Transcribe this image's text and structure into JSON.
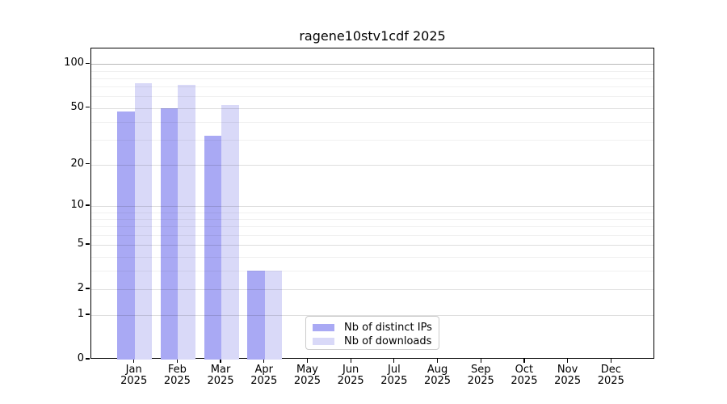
{
  "title": "ragene10stv1cdf 2025",
  "colors": {
    "distinct_ips": "#a9a9f4",
    "downloads": "#d9d9f8",
    "grid_major": "rgba(0,0,0,0.13)",
    "grid_major_100": "rgba(0,0,0,0.28)",
    "grid_minor": "rgba(0,0,0,0.06)",
    "axis": "#000000"
  },
  "legend": {
    "items": [
      {
        "label": "Nb of distinct IPs",
        "color_key": "distinct_ips"
      },
      {
        "label": "Nb of downloads",
        "color_key": "downloads"
      }
    ]
  },
  "chart_data": {
    "type": "bar",
    "title": "ragene10stv1cdf 2025",
    "categories": [
      "Jan 2025",
      "Feb 2025",
      "Mar 2025",
      "Apr 2025",
      "May 2025",
      "Jun 2025",
      "Jul 2025",
      "Aug 2025",
      "Sep 2025",
      "Oct 2025",
      "Nov 2025",
      "Dec 2025"
    ],
    "series": [
      {
        "name": "Nb of distinct IPs",
        "values": [
          47,
          50,
          32,
          3,
          null,
          null,
          null,
          null,
          null,
          null,
          null,
          null
        ]
      },
      {
        "name": "Nb of downloads",
        "values": [
          74,
          72,
          52,
          3,
          null,
          null,
          null,
          null,
          null,
          null,
          null,
          null
        ]
      }
    ],
    "xlabel": "",
    "ylabel": "",
    "yscale": "log(value+1)",
    "y_major_ticks": [
      0,
      1,
      2,
      5,
      10,
      20,
      50,
      100
    ],
    "y_minor_ticks": [
      3,
      4,
      6,
      7,
      8,
      9,
      30,
      40,
      60,
      70,
      80,
      90
    ],
    "ylim": [
      0,
      127
    ],
    "grid": true,
    "legend_position": "lower center-right inside plot"
  }
}
